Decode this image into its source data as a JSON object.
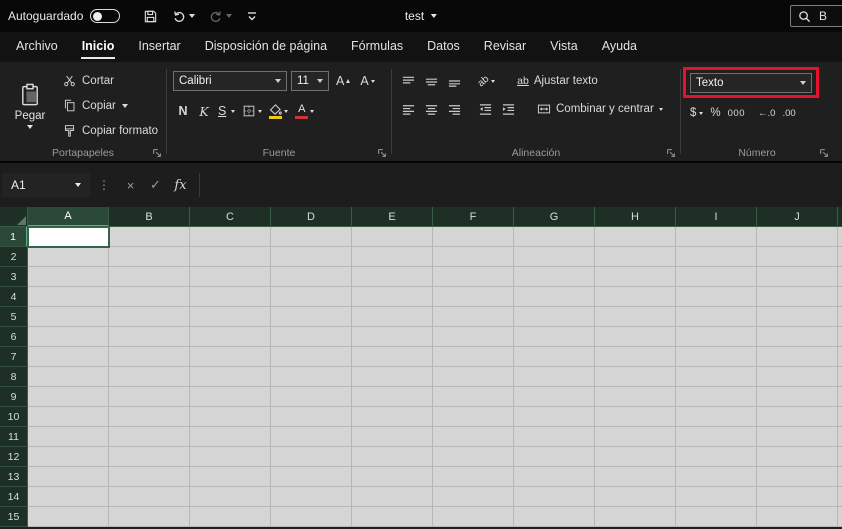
{
  "titlebar": {
    "autosave_label": "Autoguardado",
    "document_title": "test",
    "search_text": "B"
  },
  "tabs": [
    {
      "label": "Archivo",
      "active": false
    },
    {
      "label": "Inicio",
      "active": true
    },
    {
      "label": "Insertar",
      "active": false
    },
    {
      "label": "Disposición de página",
      "active": false
    },
    {
      "label": "Fórmulas",
      "active": false
    },
    {
      "label": "Datos",
      "active": false
    },
    {
      "label": "Revisar",
      "active": false
    },
    {
      "label": "Vista",
      "active": false
    },
    {
      "label": "Ayuda",
      "active": false
    }
  ],
  "ribbon": {
    "clipboard": {
      "group_label": "Portapapeles",
      "paste_label": "Pegar",
      "cut_label": "Cortar",
      "copy_label": "Copiar",
      "format_painter_label": "Copiar formato"
    },
    "font": {
      "group_label": "Fuente",
      "font_name": "Calibri",
      "font_size": "11",
      "grow_font_label": "A",
      "shrink_font_label": "A",
      "bold_label": "N",
      "italic_label": "K",
      "underline_label": "S",
      "fill_color": "#f2c811",
      "font_color": "#d13438",
      "font_color_glyph": "A"
    },
    "alignment": {
      "group_label": "Alineación",
      "orientation_glyph": "ab",
      "wrap_glyph": "ab",
      "wrap_text_label": "Ajustar texto",
      "merge_center_label": "Combinar y centrar"
    },
    "number": {
      "group_label": "Número",
      "format_value": "Texto",
      "currency_label": "$",
      "percent_label": "%",
      "thousands_label": "000",
      "increase_decimal_label": "←.0",
      "decrease_decimal_label": ".00",
      "highlight_color": "#e8112d"
    }
  },
  "formula_bar": {
    "name_box_value": "A1",
    "menu_dots": "⋮",
    "cancel_label": "×",
    "enter_label": "✓",
    "fx_label": "fx",
    "formula_value": ""
  },
  "grid": {
    "columns": [
      "A",
      "B",
      "C",
      "D",
      "E",
      "F",
      "G",
      "H",
      "I",
      "J"
    ],
    "rows": [
      "1",
      "2",
      "3",
      "4",
      "5",
      "6",
      "7",
      "8",
      "9",
      "10",
      "11",
      "12",
      "13",
      "14",
      "15"
    ],
    "selected_cell": "A1",
    "selected_column": "A",
    "selected_row": "1"
  }
}
